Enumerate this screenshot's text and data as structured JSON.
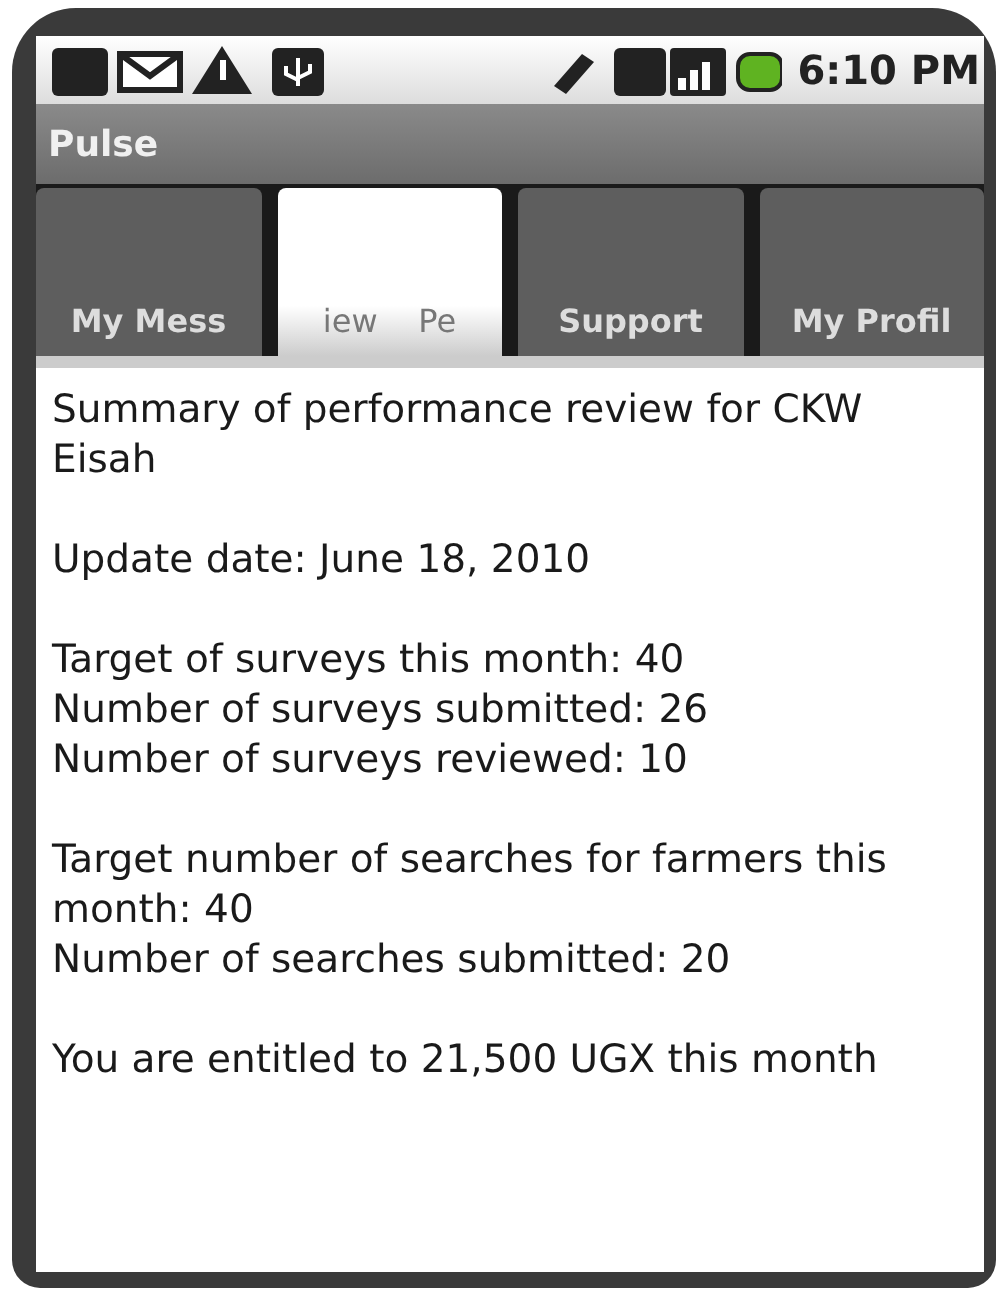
{
  "status_bar": {
    "time": "6:10 PM"
  },
  "title_bar": {
    "title": "Pulse"
  },
  "tabs": [
    {
      "label": "My Mess",
      "selected": false
    },
    {
      "label": "iew    Pe",
      "selected": true
    },
    {
      "label": "Support",
      "selected": false
    },
    {
      "label": "My Profil",
      "selected": false
    }
  ],
  "content": {
    "paragraphs": [
      [
        "Summary of performance review for CKW Eisah"
      ],
      [
        "Update date: June 18, 2010"
      ],
      [
        "Target of surveys this month: 40",
        "Number of surveys submitted: 26",
        "Number of surveys reviewed: 10"
      ],
      [
        "Target number of searches for farmers this month: 40",
        "Number of searches submitted: 20"
      ],
      [
        "You are entitled to 21,500 UGX this month"
      ]
    ]
  }
}
